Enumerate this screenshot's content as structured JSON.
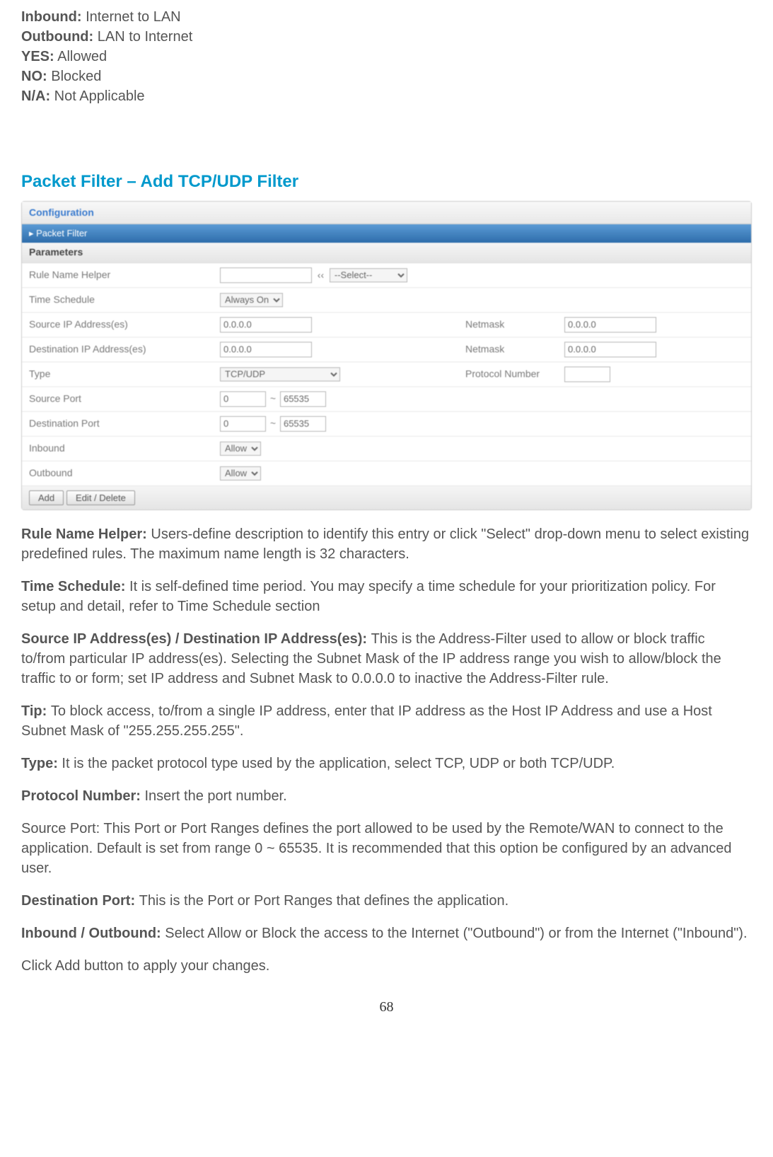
{
  "defs": {
    "inbound_label": "Inbound:",
    "inbound_text": " Internet to LAN",
    "outbound_label": "Outbound:",
    "outbound_text": " LAN to Internet",
    "yes_label": "YES:",
    "yes_text": " Allowed",
    "no_label": "NO:",
    "no_text": " Blocked",
    "na_label": "N/A:",
    "na_text": " Not Applicable"
  },
  "heading": "Packet Filter – Add TCP/UDP Filter",
  "panel": {
    "configuration": "Configuration",
    "packet_filter": "▸ Packet Filter",
    "parameters": "Parameters",
    "rule_name_label": "Rule Name  Helper",
    "rule_name_value": "",
    "helper_arrows": "‹‹",
    "helper_select": "--Select--",
    "time_schedule_label": "Time Schedule",
    "time_schedule_value": "Always On",
    "source_ip_label": "Source IP Address(es)",
    "source_ip_value": "0.0.0.0",
    "netmask1_label": "Netmask",
    "netmask1_value": "0.0.0.0",
    "dest_ip_label": "Destination IP Address(es)",
    "dest_ip_value": "0.0.0.0",
    "netmask2_label": "Netmask",
    "netmask2_value": "0.0.0.0",
    "type_label": "Type",
    "type_value": "TCP/UDP",
    "protocol_num_label": "Protocol Number",
    "protocol_num_value": "",
    "source_port_label": "Source Port",
    "source_port_from": "0",
    "source_port_to": "65535",
    "dest_port_label": "Destination Port",
    "dest_port_from": "0",
    "dest_port_to": "65535",
    "inbound_label": "Inbound",
    "inbound_value": "Allow",
    "outbound_label": "Outbound",
    "outbound_value": "Allow",
    "btn_add": "Add",
    "btn_edit": "Edit / Delete"
  },
  "descriptions": {
    "rule_helper_label": "Rule Name Helper: ",
    "rule_helper_text": "Users-define description to identify this entry or click \"Select\" drop-down menu to select existing predefined rules. The maximum name length is 32 characters.",
    "time_schedule_label": "Time Schedule: ",
    "time_schedule_text": "It is self-defined time period.  You may specify a time schedule for your prioritization policy. For setup and detail, refer to Time Schedule section",
    "ip_addr_label": "Source IP Address(es) / Destination IP Address(es): ",
    "ip_addr_text": "This is the Address-Filter used to allow or block traffic to/from particular IP address(es).  Selecting the Subnet Mask of the IP address range you wish to allow/block the traffic to or form; set IP address and Subnet Mask to 0.0.0.0 to inactive the Address-Filter rule.",
    "tip_label": "Tip: ",
    "tip_text": "To block access, to/from a single IP address, enter that IP address as the Host IP Address and use a Host Subnet Mask of \"255.255.255.255\".",
    "type_label": "Type: ",
    "type_text": "It is the packet protocol type used by the application, select TCP, UDP or both TCP/UDP.",
    "protocol_label": "Protocol Number: ",
    "protocol_text": "Insert the port number.",
    "source_port_text": "Source Port: This Port or Port Ranges defines the port allowed to be used by the Remote/WAN to connect to the application. Default is set from range 0 ~ 65535. It is recommended that this option be configured by an advanced user.",
    "dest_port_label": "Destination Port: ",
    "dest_port_text": "This is the Port or Port Ranges that defines the application.",
    "inout_label": "Inbound / Outbound: ",
    "inout_text": "Select Allow or Block the access to the Internet (\"Outbound\") or from the Internet (\"Inbound\").",
    "click_add": "Click Add button to apply your changes."
  },
  "page_number": "68"
}
